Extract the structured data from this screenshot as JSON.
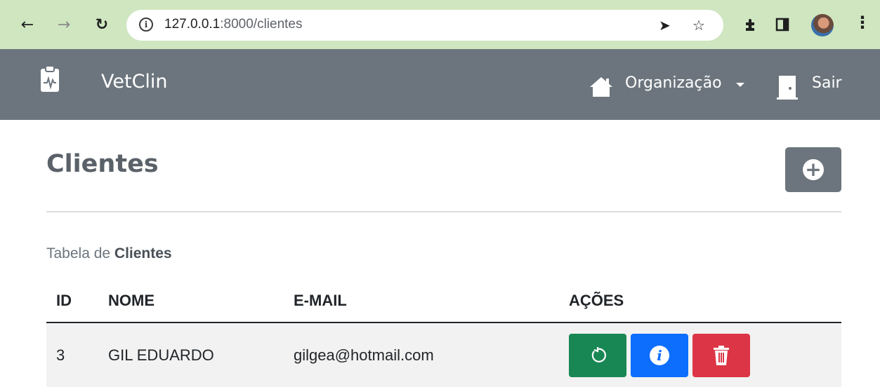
{
  "browser": {
    "url_host": "127.0.0.1",
    "url_path": ":8000/clientes"
  },
  "navbar": {
    "brand": "VetClin",
    "organization": "Organização",
    "logout": "Sair"
  },
  "page": {
    "title": "Clientes",
    "caption_prefix": "Tabela de ",
    "caption_bold": "Clientes"
  },
  "table": {
    "headers": [
      "ID",
      "NOME",
      "E-MAIL",
      "AÇÕES"
    ],
    "rows": [
      {
        "id": "3",
        "nome": "GIL EDUARDO",
        "email": "gilgea@hotmail.com"
      }
    ]
  },
  "colors": {
    "navbar": "#6c757d",
    "chrome": "#cfe6c0",
    "success": "#198754",
    "primary": "#0d6efd",
    "danger": "#dc3545"
  }
}
